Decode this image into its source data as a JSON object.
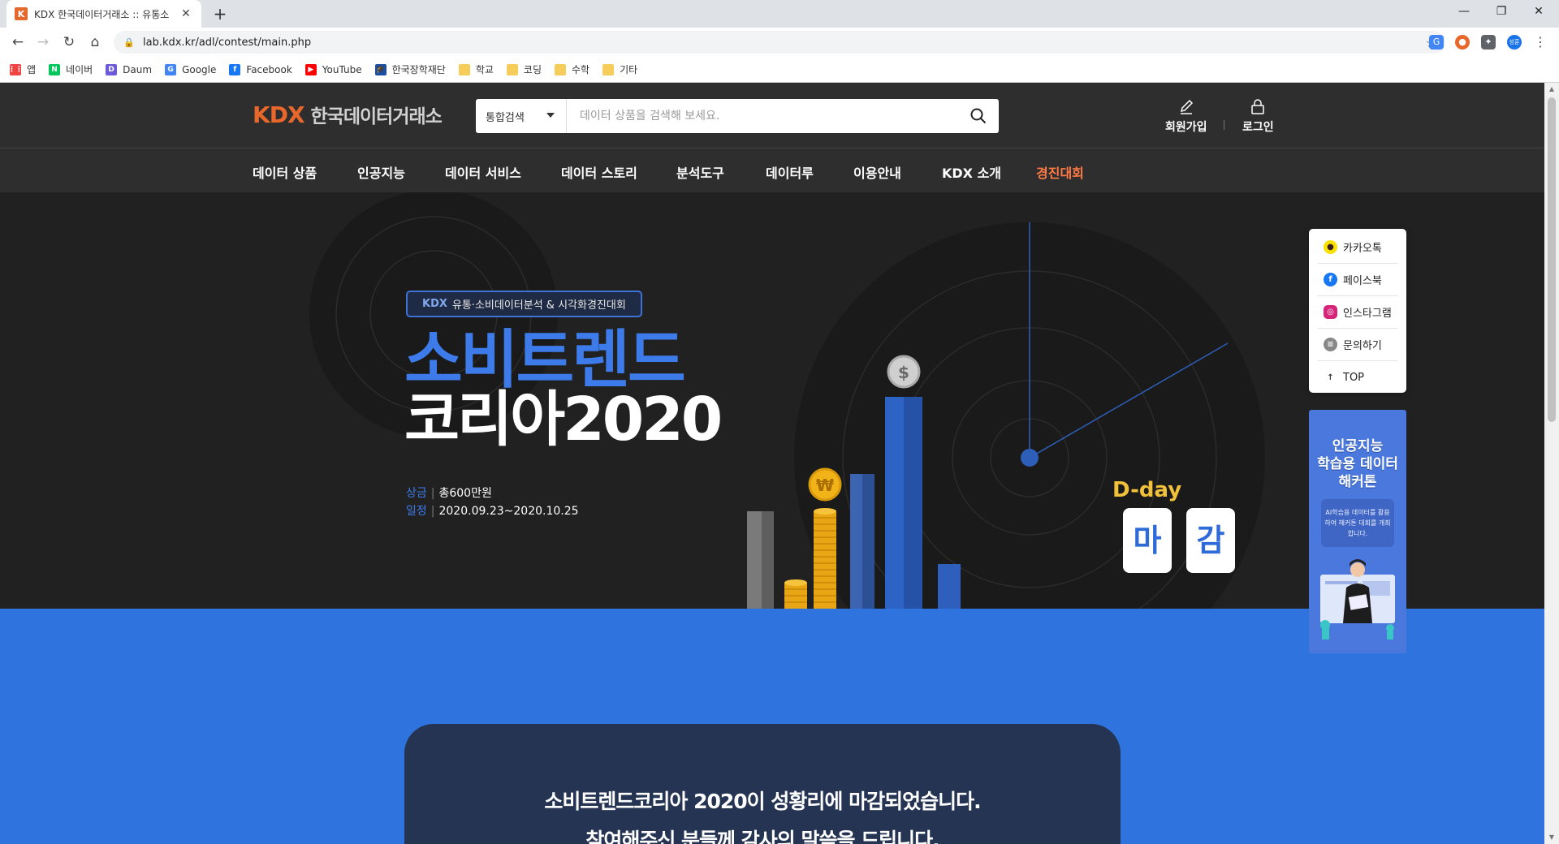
{
  "browser": {
    "tab_favicon": "K",
    "tab_title": "KDX 한국데이터거래소 :: 유통소",
    "url": "lab.kdx.kr/adl/contest/main.php",
    "profile_initial": "성훈",
    "bookmarks": [
      {
        "label": "앱",
        "icon": "apps-icon",
        "color": "#e44"
      },
      {
        "label": "네이버",
        "icon": "naver-icon",
        "color": "#03c75a"
      },
      {
        "label": "Daum",
        "icon": "daum-icon",
        "color": "#6b5bd6"
      },
      {
        "label": "Google",
        "icon": "google-icon",
        "color": "#4285f4"
      },
      {
        "label": "Facebook",
        "icon": "facebook-icon",
        "color": "#1877f2"
      },
      {
        "label": "YouTube",
        "icon": "youtube-icon",
        "color": "#ff0000"
      },
      {
        "label": "한국장학재단",
        "icon": "kosaf-icon",
        "color": "#1d4fa0"
      },
      {
        "label": "학교",
        "icon": "folder-icon",
        "color": "#f6cd5b"
      },
      {
        "label": "코딩",
        "icon": "folder-icon",
        "color": "#f6cd5b"
      },
      {
        "label": "수학",
        "icon": "folder-icon",
        "color": "#f6cd5b"
      },
      {
        "label": "기타",
        "icon": "folder-icon",
        "color": "#f6cd5b"
      }
    ]
  },
  "header": {
    "logo_mark": "KDX",
    "logo_name": "한국데이터거래소",
    "search_select": "통합검색",
    "search_placeholder": "데이터 상품을 검색해 보세요.",
    "signup": "회원가입",
    "login": "로그인"
  },
  "gnb": [
    {
      "label": "데이터 상품"
    },
    {
      "label": "인공지능"
    },
    {
      "label": "데이터 서비스"
    },
    {
      "label": "데이터 스토리"
    },
    {
      "label": "분석도구"
    },
    {
      "label": "데이터루"
    },
    {
      "label": "이용안내"
    },
    {
      "label": "KDX 소개"
    },
    {
      "label": "경진대회",
      "active": true
    }
  ],
  "hero": {
    "badge_brand": "KDX",
    "badge_text": "유통·소비데이터분석 & 시각화경진대회",
    "title_line1": "소비트렌드",
    "title_line2": "코리아2020",
    "prize_label": "상금",
    "prize_value": "총600만원",
    "schedule_label": "일정",
    "schedule_value": "2020.09.23~2020.10.25",
    "dday_label": "D-day",
    "dday_char1": "마",
    "dday_char2": "감",
    "coin_won": "₩",
    "coin_dollar": "$"
  },
  "float_sns": [
    {
      "label": "카카오톡",
      "icon": "kakaotalk-icon"
    },
    {
      "label": "페이스북",
      "icon": "facebook-icon"
    },
    {
      "label": "인스타그램",
      "icon": "instagram-icon"
    },
    {
      "label": "문의하기",
      "icon": "inquiry-icon"
    },
    {
      "label": "TOP",
      "icon": "arrow-up-icon"
    }
  ],
  "float_banner": {
    "title_line1": "인공지능",
    "title_line2": "학습용 데이터",
    "title_line3": "해커톤",
    "desc": "AI학습용 데이터를 활용하여 해커톤 대회를 개최합니다."
  },
  "notice": {
    "line1": "소비트렌드코리아 2020이 성황리에 마감되었습니다.",
    "line2": "참여해주신 분들께 감사의 말씀을 드립니다."
  },
  "colors": {
    "accent_orange": "#e8672b",
    "accent_blue": "#2f74de",
    "dday_yellow": "#f2c13a"
  }
}
